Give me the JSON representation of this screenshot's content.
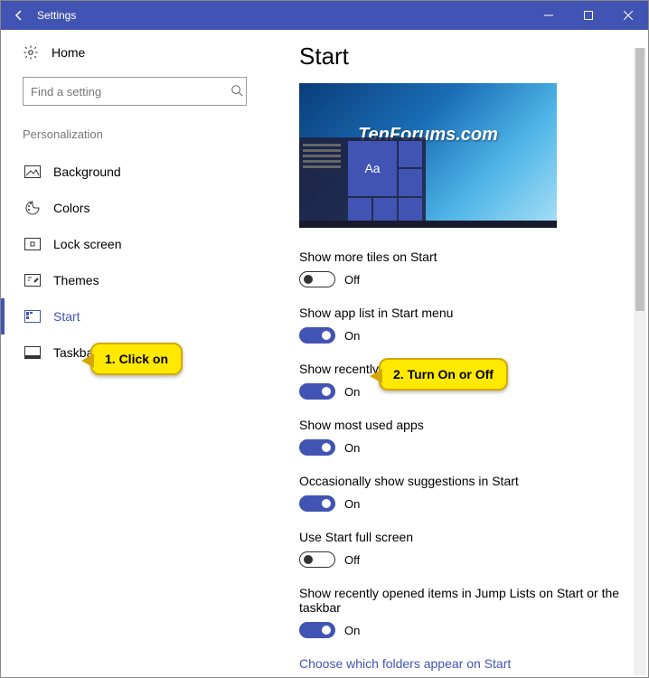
{
  "window": {
    "title": "Settings"
  },
  "sidebar": {
    "home": "Home",
    "search_placeholder": "Find a setting",
    "category": "Personalization",
    "items": [
      {
        "label": "Background"
      },
      {
        "label": "Colors"
      },
      {
        "label": "Lock screen"
      },
      {
        "label": "Themes"
      },
      {
        "label": "Start"
      },
      {
        "label": "Taskbar"
      }
    ]
  },
  "main": {
    "heading": "Start",
    "preview": {
      "watermark": "TenForums.com",
      "tile_text": "Aa"
    },
    "settings": [
      {
        "label": "Show more tiles on Start",
        "state": "Off",
        "on": false
      },
      {
        "label": "Show app list in Start menu",
        "state": "On",
        "on": true
      },
      {
        "label": "Show recently added apps",
        "state": "On",
        "on": true
      },
      {
        "label": "Show most used apps",
        "state": "On",
        "on": true
      },
      {
        "label": "Occasionally show suggestions in Start",
        "state": "On",
        "on": true
      },
      {
        "label": "Use Start full screen",
        "state": "Off",
        "on": false
      },
      {
        "label": "Show recently opened items in Jump Lists on Start or the taskbar",
        "state": "On",
        "on": true
      }
    ],
    "link": "Choose which folders appear on Start"
  },
  "callouts": {
    "c1": "1. Click on",
    "c2": "2. Turn On or Off"
  }
}
